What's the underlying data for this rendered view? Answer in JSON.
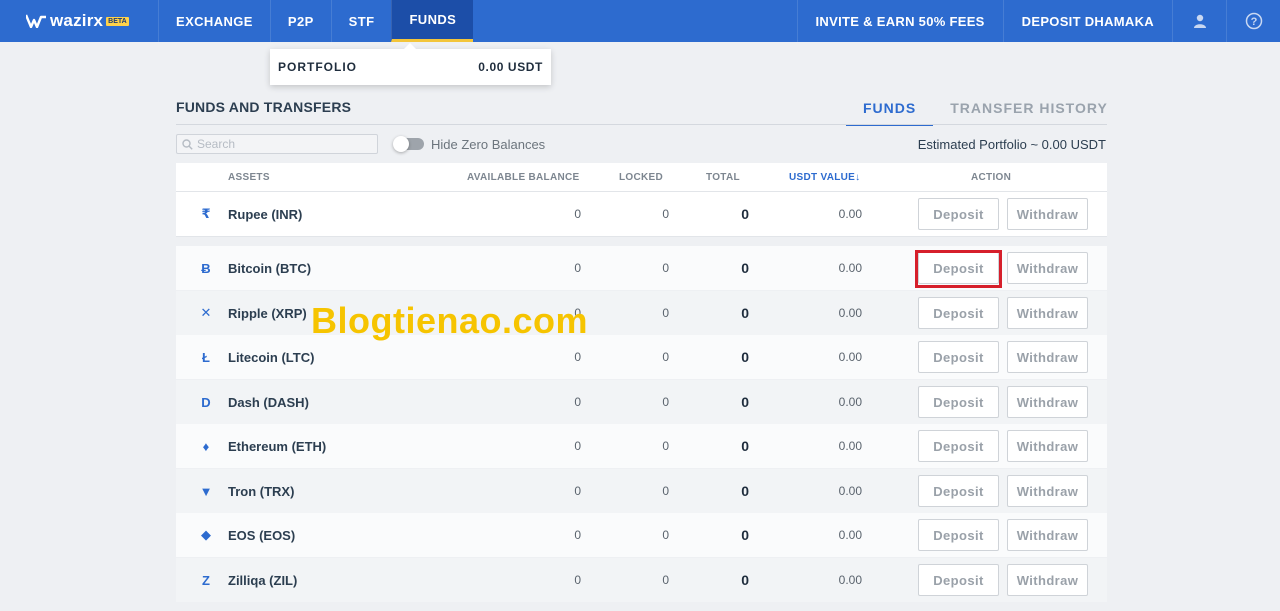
{
  "app": {
    "logo": "wazirx",
    "beta": "BETA"
  },
  "nav": {
    "items": [
      {
        "label": "EXCHANGE",
        "active": false
      },
      {
        "label": "P2P",
        "active": false
      },
      {
        "label": "STF",
        "active": false
      },
      {
        "label": "FUNDS",
        "active": true
      }
    ],
    "right": [
      "INVITE & EARN 50% FEES",
      "DEPOSIT DHAMAKA"
    ],
    "icons": [
      "user-icon",
      "help-icon"
    ]
  },
  "portfolio_popup": {
    "label": "PORTFOLIO",
    "value": "0.00 USDT"
  },
  "page": {
    "title": "FUNDS AND TRANSFERS",
    "tabs": [
      {
        "label": "FUNDS",
        "active": true
      },
      {
        "label": "TRANSFER HISTORY",
        "active": false
      }
    ],
    "search_placeholder": "Search",
    "hide_zero_label": "Hide Zero Balances",
    "estimated": "Estimated Portfolio ~  0.00 USDT"
  },
  "table": {
    "headers": {
      "assets": "ASSETS",
      "available": "AVAILABLE BALANCE",
      "locked": "LOCKED",
      "total": "TOTAL",
      "usdt": "USDT VALUE↓",
      "action": "ACTION"
    },
    "deposit_label": "Deposit",
    "withdraw_label": "Withdraw",
    "rows": [
      {
        "name": "Rupee (INR)",
        "icon": "rupee-icon",
        "glyph": "₹",
        "available": "0",
        "locked": "0",
        "total": "0",
        "usdt": "0.00"
      },
      {
        "name": "Bitcoin (BTC)",
        "icon": "bitcoin-icon",
        "glyph": "Ƀ",
        "available": "0",
        "locked": "0",
        "total": "0",
        "usdt": "0.00"
      },
      {
        "name": "Ripple (XRP)",
        "icon": "ripple-icon",
        "glyph": "✕",
        "available": "0",
        "locked": "0",
        "total": "0",
        "usdt": "0.00"
      },
      {
        "name": "Litecoin (LTC)",
        "icon": "litecoin-icon",
        "glyph": "Ł",
        "available": "0",
        "locked": "0",
        "total": "0",
        "usdt": "0.00"
      },
      {
        "name": "Dash (DASH)",
        "icon": "dash-icon",
        "glyph": "D",
        "available": "0",
        "locked": "0",
        "total": "0",
        "usdt": "0.00"
      },
      {
        "name": "Ethereum (ETH)",
        "icon": "ethereum-icon",
        "glyph": "♦",
        "available": "0",
        "locked": "0",
        "total": "0",
        "usdt": "0.00"
      },
      {
        "name": "Tron (TRX)",
        "icon": "tron-icon",
        "glyph": "▼",
        "available": "0",
        "locked": "0",
        "total": "0",
        "usdt": "0.00"
      },
      {
        "name": "EOS (EOS)",
        "icon": "eos-icon",
        "glyph": "◆",
        "available": "0",
        "locked": "0",
        "total": "0",
        "usdt": "0.00"
      },
      {
        "name": "Zilliqa (ZIL)",
        "icon": "zilliqa-icon",
        "glyph": "Z",
        "available": "0",
        "locked": "0",
        "total": "0",
        "usdt": "0.00"
      }
    ]
  },
  "watermark": "Blogtienao.com",
  "colors": {
    "nav": "#2d6bcf",
    "nav_active": "#1c4ea8",
    "accent_underline": "#f3c53a",
    "highlight": "#d61f2b",
    "watermark": "#f6c400"
  }
}
